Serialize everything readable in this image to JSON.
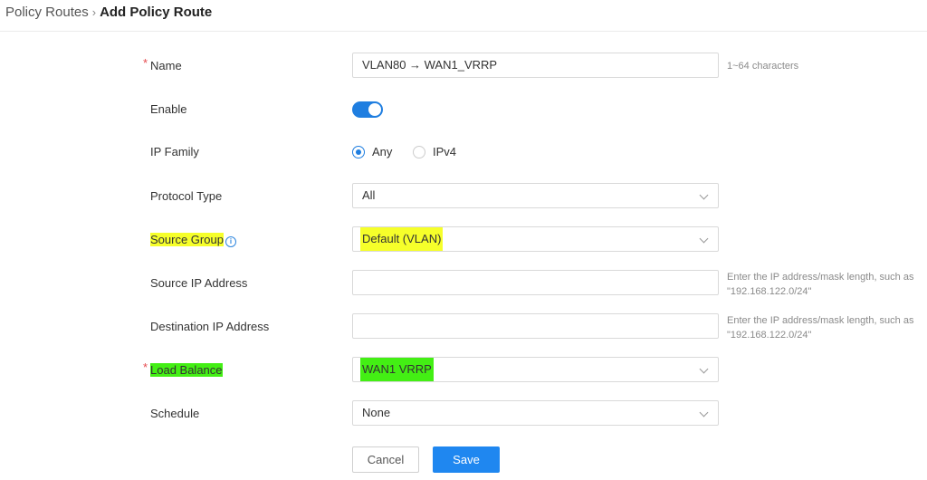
{
  "breadcrumb": {
    "parent": "Policy Routes",
    "separator": "›",
    "current": "Add Policy Route"
  },
  "form": {
    "name": {
      "label": "Name",
      "required_mark": "*",
      "value": "VLAN80 → WAN1_VRRP",
      "hint": "1~64 characters"
    },
    "enable": {
      "label": "Enable",
      "on": true
    },
    "ip_family": {
      "label": "IP Family",
      "options": [
        "Any",
        "IPv4"
      ],
      "selected": "Any"
    },
    "protocol_type": {
      "label": "Protocol Type",
      "value": "All"
    },
    "source_group": {
      "label": "Source Group",
      "value": "Default (VLAN)",
      "info_icon": "info-circle-icon",
      "highlight": "#f6ff2a"
    },
    "source_ip": {
      "label": "Source IP Address",
      "value": "",
      "hint_line1": "Enter the IP address/mask length, such as",
      "hint_line2": "\"192.168.122.0/24\""
    },
    "destination_ip": {
      "label": "Destination IP Address",
      "value": "",
      "hint_line1": "Enter the IP address/mask length, such as",
      "hint_line2": "\"192.168.122.0/24\""
    },
    "load_balance": {
      "label": "Load Balance",
      "required_mark": "*",
      "value": "WAN1 VRRP",
      "highlight": "#43ef14"
    },
    "schedule": {
      "label": "Schedule",
      "value": "None"
    }
  },
  "buttons": {
    "cancel": "Cancel",
    "save": "Save"
  },
  "colors": {
    "accent": "#1f7ee0",
    "required": "#e5484d",
    "hint": "#8a8a8a"
  }
}
